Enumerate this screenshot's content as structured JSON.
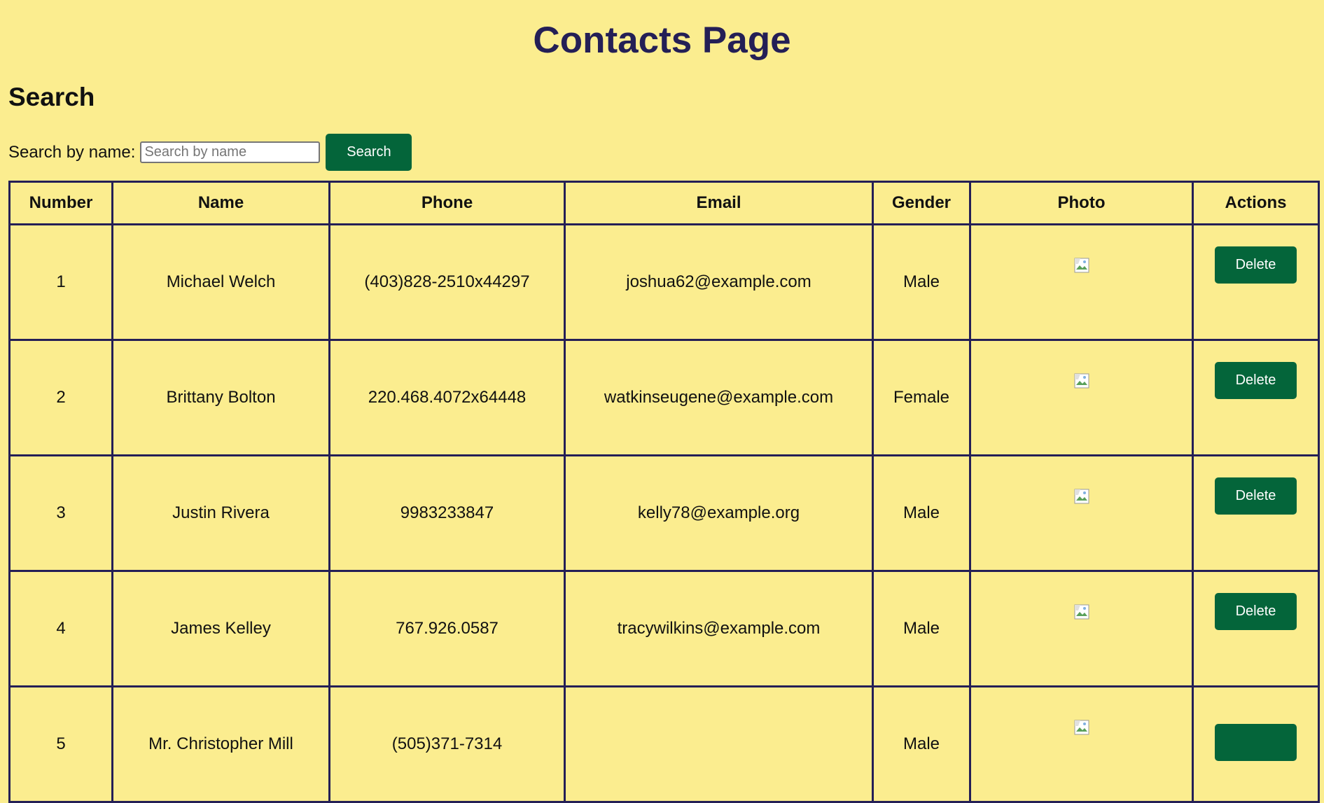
{
  "page": {
    "title": "Contacts Page"
  },
  "search": {
    "heading": "Search",
    "label": "Search by name:",
    "placeholder": "Search by name",
    "button_label": "Search"
  },
  "table": {
    "headers": [
      "Number",
      "Name",
      "Phone",
      "Email",
      "Gender",
      "Photo",
      "Actions"
    ],
    "rows": [
      {
        "number": "1",
        "name": "Michael Welch",
        "phone": "(403)828-2510x44297",
        "email": "joshua62@example.com",
        "gender": "Male",
        "photo_icon": "broken-image-icon",
        "action_label": "Delete"
      },
      {
        "number": "2",
        "name": "Brittany Bolton",
        "phone": "220.468.4072x64448",
        "email": "watkinseugene@example.com",
        "gender": "Female",
        "photo_icon": "broken-image-icon",
        "action_label": "Delete"
      },
      {
        "number": "3",
        "name": "Justin Rivera",
        "phone": "9983233847",
        "email": "kelly78@example.org",
        "gender": "Male",
        "photo_icon": "broken-image-icon",
        "action_label": "Delete"
      },
      {
        "number": "4",
        "name": "James Kelley",
        "phone": "767.926.0587",
        "email": "tracywilkins@example.com",
        "gender": "Male",
        "photo_icon": "broken-image-icon",
        "action_label": "Delete"
      },
      {
        "number": "5",
        "name": "Mr. Christopher Mill",
        "phone": "(505)371-7314",
        "email": "",
        "gender": "Male",
        "photo_icon": "broken-image-icon",
        "action_label": ""
      }
    ]
  },
  "colors": {
    "background": "#fbed8f",
    "title": "#241f56",
    "button": "#04653a",
    "border": "#241f56"
  }
}
